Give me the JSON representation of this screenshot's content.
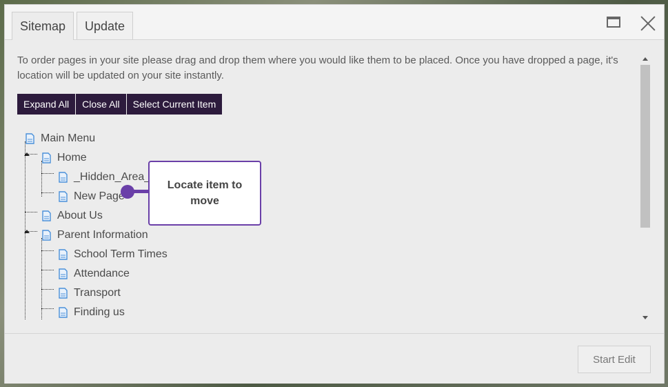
{
  "tabs": [
    {
      "label": "Sitemap",
      "active": true
    },
    {
      "label": "Update",
      "active": false
    }
  ],
  "window_controls": {
    "maximize_icon": "maximize-icon",
    "close_icon": "close-icon"
  },
  "intro_text": "To order pages in your site please drag and drop them where you would like them to be placed. Once you have dropped a page, it's location will be updated on your site instantly.",
  "toolbar": {
    "expand_all": "Expand All",
    "close_all": "Close All",
    "select_current": "Select Current Item"
  },
  "tree": {
    "root": "Main Menu",
    "home": "Home",
    "home_children": [
      "_Hidden_Area_",
      "New Page"
    ],
    "about": "About Us",
    "parent_info": "Parent Information",
    "parent_children": [
      "School Term Times",
      "Attendance",
      "Transport",
      "Finding us"
    ]
  },
  "callout": {
    "text": "Locate item to move"
  },
  "footer": {
    "start_edit": "Start Edit"
  },
  "colors": {
    "accent": "#2d1b3d",
    "callout": "#6a3fa8",
    "page_icon": "#4a90d9"
  }
}
